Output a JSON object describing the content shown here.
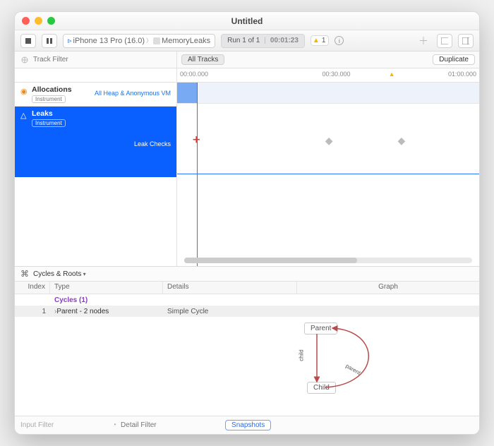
{
  "window": {
    "title": "Untitled"
  },
  "toolbar": {
    "device": "iPhone 13 Pro (16.0)",
    "process": "MemoryLeaks",
    "run_label": "Run 1 of 1",
    "run_time": "00:01:23",
    "warn_count": "1"
  },
  "filterrow": {
    "track_filter_placeholder": "Track Filter",
    "all_tracks": "All Tracks",
    "duplicate": "Duplicate"
  },
  "ruler": {
    "t0": "00:00.000",
    "t1": "00:30.000",
    "t2": "01:00.000"
  },
  "tracks": {
    "alloc_title": "Allocations",
    "instrument_chip": "Instrument",
    "alloc_mode": "All Heap & Anonymous VM",
    "leaks_title": "Leaks",
    "leak_row_label": "Leak Checks"
  },
  "detail": {
    "view": "Cycles & Roots"
  },
  "table": {
    "headers": {
      "index": "Index",
      "type": "Type",
      "details": "Details",
      "graph": "Graph"
    },
    "group_label": "Cycles (1)",
    "rows": [
      {
        "index": "1",
        "type": "Parent - 2 nodes",
        "details": "Simple Cycle"
      }
    ]
  },
  "graph": {
    "parent_node": "Parent",
    "child_node": "Child",
    "edge_child": "child",
    "edge_parent": "parent"
  },
  "bottombar": {
    "input_filter": "Input Filter",
    "detail_filter_placeholder": "Detail Filter",
    "snapshots": "Snapshots"
  }
}
